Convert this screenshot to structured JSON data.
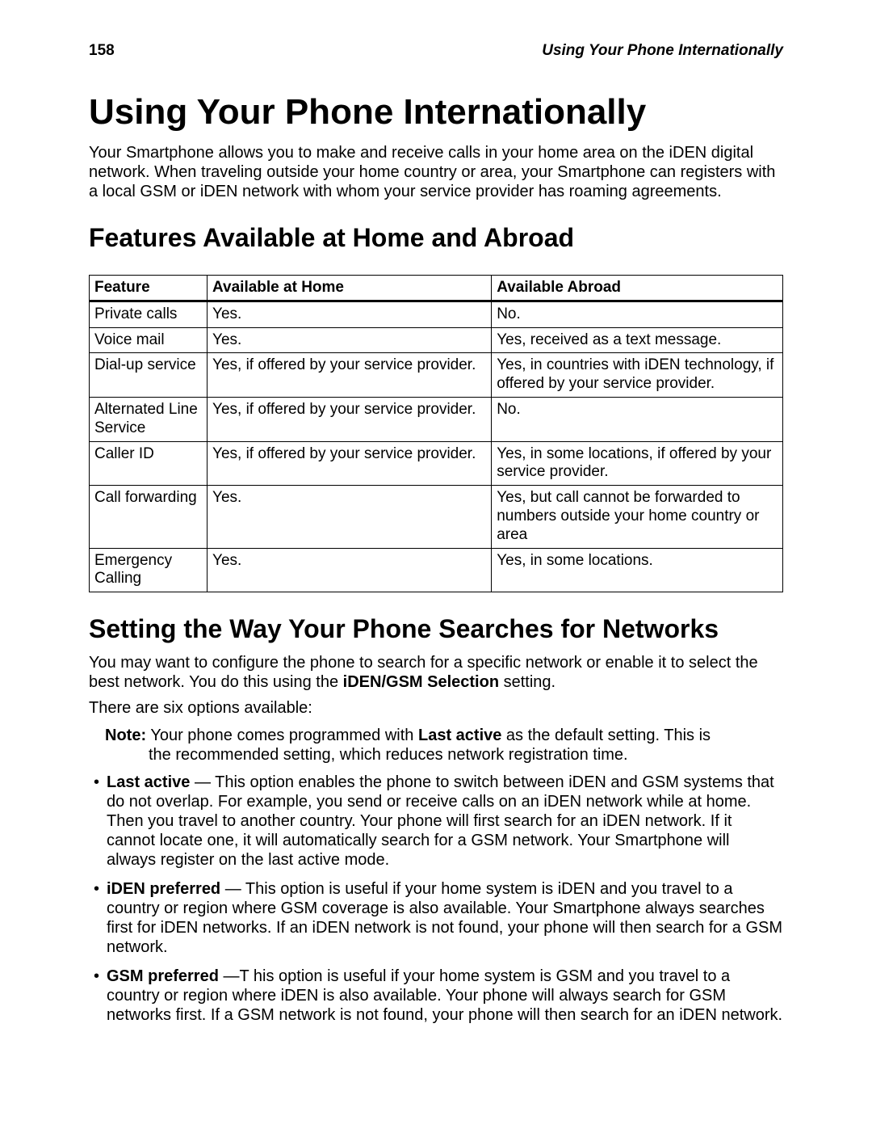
{
  "header": {
    "page_number": "158",
    "running_title": "Using Your Phone Internationally"
  },
  "title": "Using Your Phone Internationally",
  "intro": "Your Smartphone allows you to make and receive calls in your home area on the iDEN digital network. When traveling outside your home country or area, your Smartphone can registers with a local GSM or iDEN network with whom your service provider has roaming agreements.",
  "section1_heading": "Features Available at Home and Abroad",
  "table": {
    "headers": {
      "feature": "Feature",
      "home": "Available at Home",
      "abroad": "Available Abroad"
    },
    "rows": [
      {
        "feature": "Private calls",
        "home": "Yes.",
        "abroad": "No."
      },
      {
        "feature": "Voice mail",
        "home": "Yes.",
        "abroad": "Yes, received as a text message."
      },
      {
        "feature": "Dial-up service",
        "home": "Yes, if offered by your service provider.",
        "abroad": "Yes, in countries with iDEN technology, if offered by your service provider."
      },
      {
        "feature": "Alternated Line Service",
        "home": "Yes, if offered by your service provider.",
        "abroad": "No."
      },
      {
        "feature": "Caller ID",
        "home": "Yes, if offered by your service provider.",
        "abroad": "Yes, in some locations, if offered by your service provider."
      },
      {
        "feature": "Call forwarding",
        "home": "Yes.",
        "abroad": "Yes, but call cannot be forwarded to numbers outside your home country or area"
      },
      {
        "feature": "Emergency Calling",
        "home": "Yes.",
        "abroad": "Yes, in some locations."
      }
    ]
  },
  "section2_heading": "Setting the Way Your Phone Searches for Networks",
  "section2_body1_pre": "You may want to configure the phone to search for a specific network or enable it to select the best network. You do this using the ",
  "section2_body1_bold": "iDEN/GSM Selection",
  "section2_body1_post": " setting.",
  "section2_body2": "There are six options available:",
  "note": {
    "label": "Note:",
    "pre": " Your phone comes programmed with ",
    "bold": "Last active",
    "mid": " as the default setting. This is ",
    "cont": "the recommended setting, which reduces network registration time."
  },
  "options": [
    {
      "name": "Last active",
      "desc": " — This option enables the phone to switch between iDEN and GSM systems that do not overlap. For example, you send or receive calls on an iDEN network while at home. Then you travel to another country. Your phone will first search for an iDEN network. If it cannot locate one, it will automatically search for a GSM network. Your Smartphone will always register on the last active mode."
    },
    {
      "name": "iDEN preferred",
      "desc": " — This option is useful if your home system is iDEN and you travel to a country or region where GSM coverage is also available. Your Smartphone always searches first for iDEN networks. If an iDEN network is not found, your phone will then search for a GSM network."
    },
    {
      "name": "GSM preferred",
      "desc": " —T his option is useful if your home system is GSM and you travel to a country or region where iDEN is also available. Your phone will always search for GSM networks first. If a GSM network is not found, your phone will then search for an iDEN network."
    }
  ]
}
